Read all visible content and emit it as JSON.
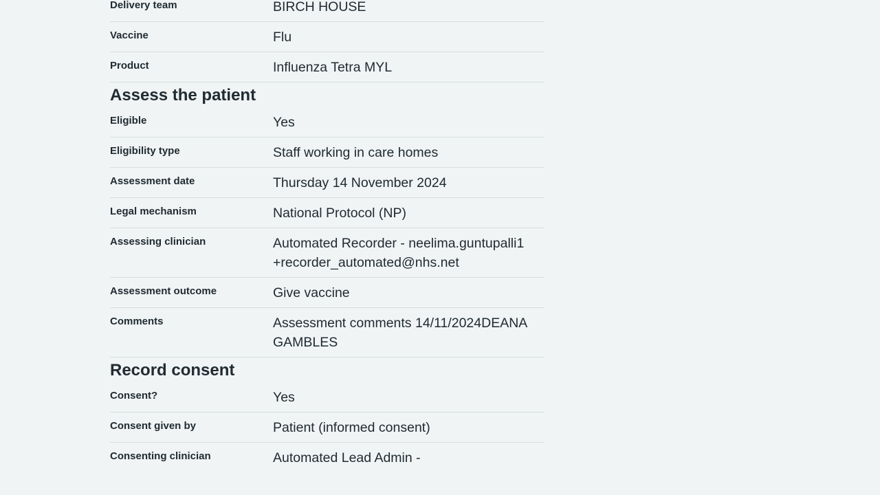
{
  "vaccine_details": [
    {
      "key": "Delivery team",
      "value": "BIRCH HOUSE"
    },
    {
      "key": "Vaccine",
      "value": "Flu"
    },
    {
      "key": "Product",
      "value": "Influenza Tetra MYL"
    }
  ],
  "assess": {
    "heading": "Assess the patient",
    "rows": [
      {
        "key": "Eligible",
        "value": "Yes"
      },
      {
        "key": "Eligibility type",
        "value": "Staff working in care homes"
      },
      {
        "key": "Assessment date",
        "value": "Thursday 14 November 2024"
      },
      {
        "key": "Legal mechanism",
        "value": "National Protocol (NP)"
      },
      {
        "key": "Assessing clinician",
        "value": "Automated Recorder - neelima.guntupalli1+recorder_automated@nhs.net"
      },
      {
        "key": "Assessment outcome",
        "value": "Give vaccine"
      },
      {
        "key": "Comments",
        "value": "Assessment comments 14/11/2024DEANA GAMBLES"
      }
    ]
  },
  "consent": {
    "heading": "Record consent",
    "rows": [
      {
        "key": "Consent?",
        "value": "Yes"
      },
      {
        "key": "Consent given by",
        "value": "Patient (informed consent)"
      },
      {
        "key": "Consenting clinician",
        "value": "Automated Lead Admin -"
      }
    ]
  }
}
